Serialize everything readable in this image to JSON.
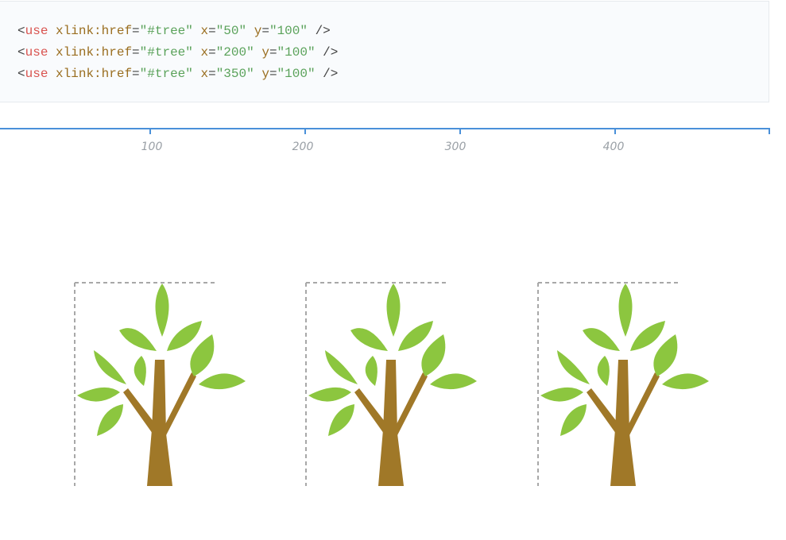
{
  "code": {
    "lines": [
      {
        "open": "<",
        "tag": "use",
        "attr1": "xlink:href",
        "eq1": "=",
        "val1": "\"#tree\"",
        "attr2": "x",
        "eq2": "=",
        "val2": "\"50\"",
        "attr3": "y",
        "eq3": "=",
        "val3": "\"100\"",
        "close": "/>"
      },
      {
        "open": "<",
        "tag": "use",
        "attr1": "xlink:href",
        "eq1": "=",
        "val1": "\"#tree\"",
        "attr2": "x",
        "eq2": "=",
        "val2": "\"200\"",
        "attr3": "y",
        "eq3": "=",
        "val3": "\"100\"",
        "close": "/>"
      },
      {
        "open": "<",
        "tag": "use",
        "attr1": "xlink:href",
        "eq1": "=",
        "val1": "\"#tree\"",
        "attr2": "x",
        "eq2": "=",
        "val2": "\"350\"",
        "attr3": "y",
        "eq3": "=",
        "val3": "\"100\"",
        "close": "/>"
      }
    ]
  },
  "ruler": {
    "labels": [
      "100",
      "200",
      "300",
      "400"
    ],
    "color": "#4a90d9"
  },
  "trees": {
    "count": 3,
    "leaf_color": "#8cc63f",
    "trunk_color": "#a07828",
    "outline_color": "#a8a8a8"
  }
}
